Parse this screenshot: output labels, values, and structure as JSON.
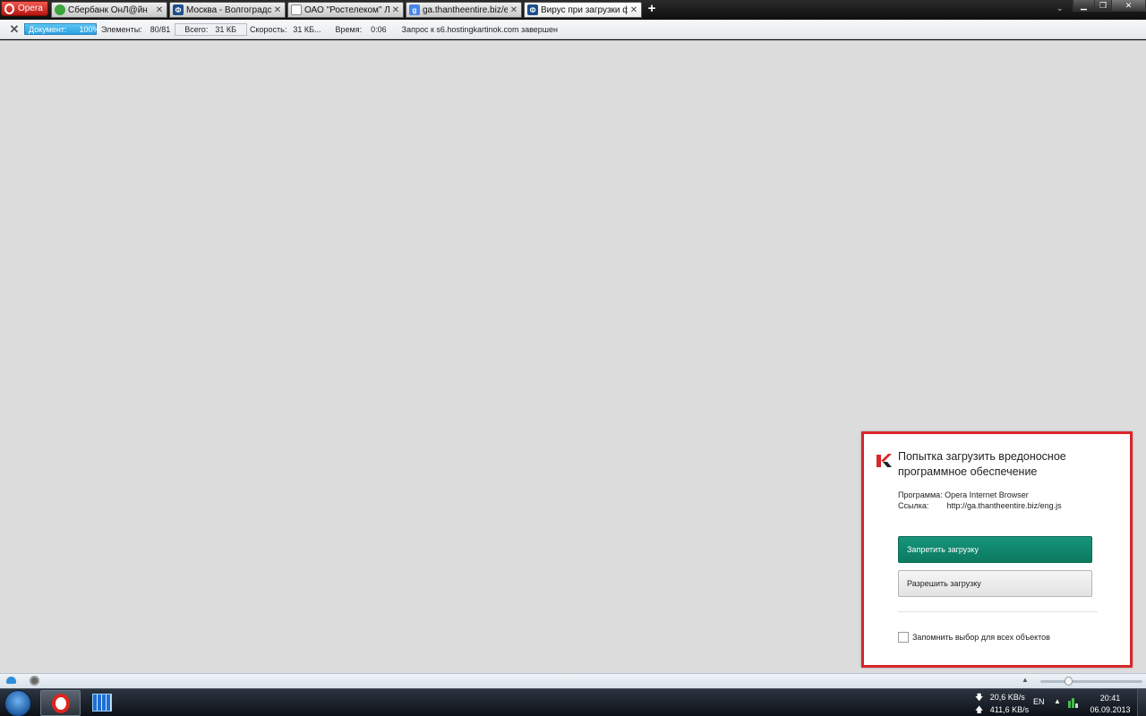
{
  "browser": {
    "menu_label": "Opera",
    "tabs": [
      {
        "title": "Сбербанк ОнЛ@йн",
        "favicon": "sberbank-icon",
        "color": "#3aa53a"
      },
      {
        "title": "Москва - Волгоградск...",
        "favicon": "f-icon",
        "color": "#1d4f8c"
      },
      {
        "title": "ОАО \"Ростелеком\" Ли...",
        "favicon": "page-icon",
        "color": "#ffffff"
      },
      {
        "title": "ga.thantheentire.biz/en...",
        "favicon": "google-icon",
        "color": "#4a86e8"
      },
      {
        "title": "Вирус при загрузки ф...",
        "favicon": "f-icon",
        "color": "#1d4f8c"
      }
    ],
    "new_tab_symbol": "+",
    "tab_list_symbol": "⌄"
  },
  "progress": {
    "close_symbol": "✕",
    "document_label": "Документ:",
    "document_value": "100%",
    "elements_label": "Элементы:",
    "elements_value": "80/81",
    "total_label": "Всего:",
    "total_value": "31 КБ",
    "speed_label": "Скорость:",
    "speed_value": "31 КБ...",
    "time_label": "Время:",
    "time_value": "0:06",
    "status": "Запрос к s6.hostingkartinok.com завершен"
  },
  "notification": {
    "title": "Попытка загрузить вредоносное программное обеспечение",
    "program_label": "Программа:",
    "program_value": "Opera Internet Browser",
    "link_label": "Ссылка:",
    "link_value": "http://ga.thantheentire.biz/eng.js",
    "deny_label": "Запретить загрузку",
    "allow_label": "Разрешить загрузку",
    "remember_label": "Запомнить выбор для всех объектов",
    "accent_color": "#d9262a",
    "deny_color": "#11896f"
  },
  "taskbar": {
    "down_speed": "20,6 KB/s",
    "up_speed": "411,6 KB/s",
    "lang": "EN",
    "time": "20:41",
    "date": "06.09.2013"
  }
}
